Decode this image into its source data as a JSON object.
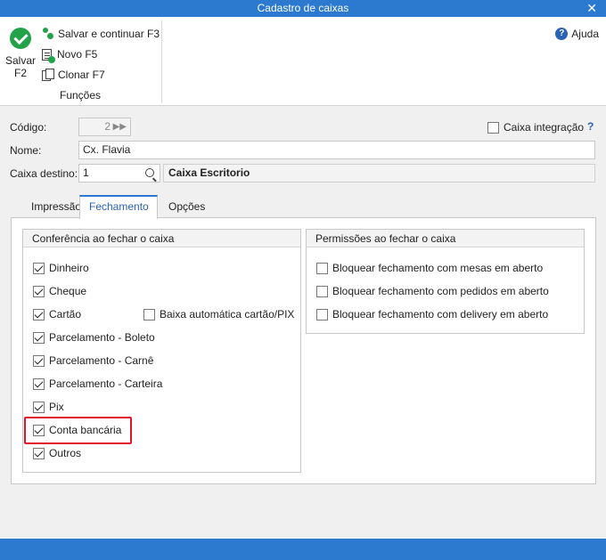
{
  "window": {
    "title": "Cadastro de caixas"
  },
  "ribbon": {
    "save_label": "Salvar",
    "save_shortcut": "F2",
    "save_continue": "Salvar e continuar F3",
    "novo": "Novo F5",
    "clonar": "Clonar F7",
    "group_label": "Funções",
    "help": "Ajuda"
  },
  "form": {
    "codigo_label": "Código:",
    "codigo_value": "2",
    "caixa_integracao_label": "Caixa integração",
    "caixa_integracao_help": "?",
    "nome_label": "Nome:",
    "nome_value": "Cx. Flavia",
    "caixa_destino_label": "Caixa destino:",
    "caixa_destino_value": "1",
    "caixa_destino_name": "Caixa Escritorio"
  },
  "tabs": [
    {
      "label": "Impressão"
    },
    {
      "label": "Fechamento"
    },
    {
      "label": "Opções"
    }
  ],
  "conferencia": {
    "title": "Conferência ao fechar o caixa",
    "items": [
      {
        "label": "Dinheiro",
        "checked": true
      },
      {
        "label": "Cheque",
        "checked": true
      },
      {
        "label": "Cartão",
        "checked": true
      },
      {
        "label": "Parcelamento - Boleto",
        "checked": true
      },
      {
        "label": "Parcelamento - Carnê",
        "checked": true
      },
      {
        "label": "Parcelamento - Carteira",
        "checked": true
      },
      {
        "label": "Pix",
        "checked": true
      },
      {
        "label": "Conta bancária",
        "checked": true
      },
      {
        "label": "Outros",
        "checked": true
      }
    ],
    "baixa_label": "Baixa automática cartão/PIX"
  },
  "permissoes": {
    "title": "Permissões ao fechar o caixa",
    "items": [
      {
        "label": "Bloquear fechamento com mesas em aberto",
        "checked": false
      },
      {
        "label": "Bloquear fechamento com pedidos em aberto",
        "checked": false
      },
      {
        "label": "Bloquear fechamento com delivery em aberto",
        "checked": false
      }
    ]
  },
  "colors": {
    "accent": "#2b7ad0",
    "success": "#22a34a",
    "highlight": "#e2142d"
  }
}
